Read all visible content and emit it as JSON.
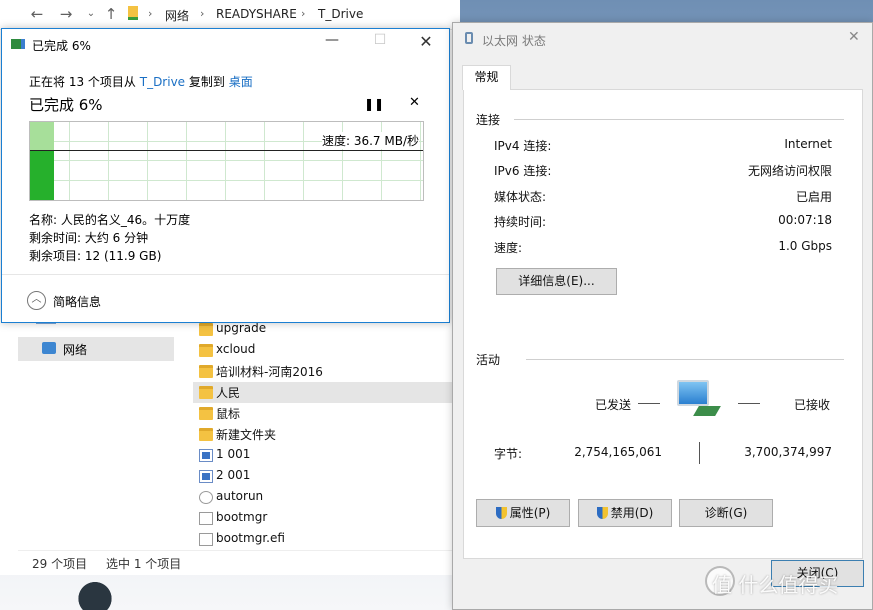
{
  "explorer": {
    "breadcrumb": [
      "网络",
      "READYSHARE",
      "T_Drive"
    ],
    "sidebar_network": "网络",
    "files": [
      {
        "name": "upgrade",
        "icon": "folder-icon"
      },
      {
        "name": "xcloud",
        "icon": "folder-icon"
      },
      {
        "name": "培训材料-河南2016",
        "icon": "folder-icon"
      },
      {
        "name": "人民",
        "icon": "folder-icon"
      },
      {
        "name": "鼠标",
        "icon": "folder-icon"
      },
      {
        "name": "新建文件夹",
        "icon": "folder-icon"
      },
      {
        "name": "1 001",
        "icon": "image-file-icon"
      },
      {
        "name": "2 001",
        "icon": "image-file-icon"
      },
      {
        "name": "autorun",
        "icon": "settings-file-icon"
      },
      {
        "name": "bootmgr",
        "icon": "file-icon"
      },
      {
        "name": "bootmgr.efi",
        "icon": "file-icon"
      }
    ],
    "selected_index": 3,
    "status_count": "29 个项目",
    "status_selected": "选中 1 个项目"
  },
  "copy": {
    "title": "已完成 6%",
    "desc_prefix": "正在将 13 个项目从",
    "source": "T_Drive",
    "desc_mid": "复制到",
    "dest": "桌面",
    "heading": "已完成 6%",
    "pause_icon": "pause-icon",
    "close_icon": "close-icon",
    "progress": 0.06,
    "speed": "速度: 36.7 MB/秒",
    "name_line": "名称: 人民的名义_46。十万度",
    "time_line": "剩余时间: 大约 6 分钟",
    "items_line": "剩余项目: 12 (11.9 GB)",
    "less_info": "简略信息",
    "colors": {
      "accent": "#1b7fd2",
      "bar": "#26b02c",
      "bar_light": "#a7df9a"
    }
  },
  "eth": {
    "title": "以太网 状态",
    "tab": "常规",
    "section_conn": "连接",
    "rows": [
      {
        "label": "IPv4 连接:",
        "value": "Internet"
      },
      {
        "label": "IPv6 连接:",
        "value": "无网络访问权限"
      },
      {
        "label": "媒体状态:",
        "value": "已启用"
      },
      {
        "label": "持续时间:",
        "value": "00:07:18"
      },
      {
        "label": "速度:",
        "value": "1.0 Gbps"
      }
    ],
    "details_btn": "详细信息(E)...",
    "section_activity": "活动",
    "sent": "已发送",
    "received": "已接收",
    "bytes_label": "字节:",
    "bytes_sent": "2,754,165,061",
    "bytes_received": "3,700,374,997",
    "btn_props": "属性(P)",
    "btn_disable": "禁用(D)",
    "btn_diagnose": "诊断(G)",
    "btn_close": "关闭(C)"
  },
  "watermark": "值 什么值得买"
}
